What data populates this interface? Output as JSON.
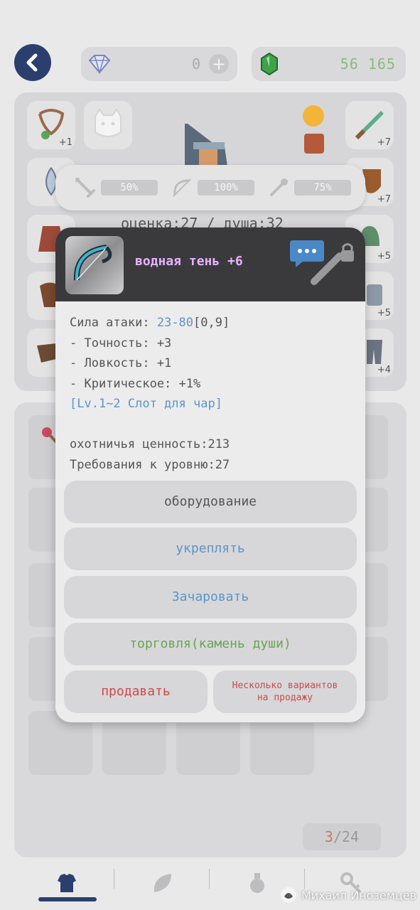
{
  "header": {
    "gems": "0",
    "money": "56 165"
  },
  "equipment": {
    "slot_left_1_plus": "+1",
    "slot_right_1_plus": "+7",
    "slot_right_2_plus": "+7",
    "slot_right_3_plus": "+5",
    "slot_right_4_plus": "+5",
    "slot_right_5_plus": "+4"
  },
  "stats": {
    "attack_pct": "50%",
    "accuracy_pct": "100%",
    "magic_pct": "75%",
    "score_line": "оценка:27 / душа:32"
  },
  "item": {
    "name": "водная тень +6",
    "attack_label": "Сила атаки:",
    "attack_value": "23-80",
    "attack_extra": "[0,9]",
    "accuracy": "- Точность: +3",
    "agility": "- Ловкость: +1",
    "critical": "- Критическое: +1%",
    "slot_info": "[Lv.1~2 Слот для чар]",
    "hunting_value": "охотничья ценность:213",
    "level_req": "Требования к уровню:27"
  },
  "actions": {
    "equip": "оборудование",
    "strengthen": "укреплять",
    "enchant": "Зачаровать",
    "trade": "торговля(камень души)",
    "sell": "продавать",
    "sell_multi_line1": "Несколько вариантов",
    "sell_multi_line2": "на продажу"
  },
  "inventory": {
    "count_current": "3",
    "count_total": "/24"
  },
  "watermark": "Михаил Иноземцев",
  "colors": {
    "accent_dark_blue": "#2b3f6e",
    "item_name_purple": "#e6b3ff",
    "stat_blue": "#5b95c8",
    "trade_green": "#6aa454",
    "sell_red": "#cc4a4a",
    "money_green": "#8bbb7a"
  },
  "icons": {
    "back": "chevron-left-icon",
    "gem": "diamond-icon",
    "money": "green-gem-icon",
    "attack": "sword-icon",
    "accuracy": "bow-icon",
    "magic": "wand-icon",
    "tabs": [
      "armor-icon",
      "leaf-icon",
      "potion-icon",
      "key-icon"
    ]
  }
}
